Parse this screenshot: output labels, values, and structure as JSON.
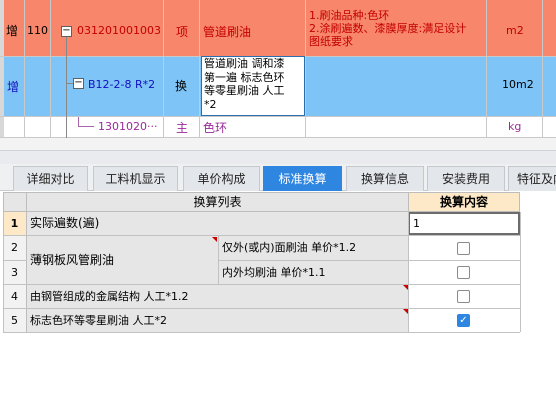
{
  "rows": [
    {
      "op": "增",
      "no": "110",
      "code": "031201001003",
      "type": "项",
      "name": "管道刷油",
      "feature_lines": [
        "1.刷油品种:色环",
        "2.涂刷遍数、漆膜厚度:满足设计",
        "图纸要求"
      ],
      "unit": "m2",
      "expander": "−"
    },
    {
      "op": "增",
      "code": "B12-2-8 R*2",
      "type": "换",
      "name_lines": [
        "管道刷油 调和漆",
        "第一遍  标志色环",
        "等零星刷油 人工",
        "*2"
      ],
      "unit": "10m2",
      "expander": "−"
    },
    {
      "code": "1301020···",
      "type": "主",
      "name": "色环",
      "unit": "kg"
    }
  ],
  "tabs": [
    "详细对比",
    "工料机显示",
    "单价构成",
    "标准换算",
    "换算信息",
    "安装费用",
    "特征及内"
  ],
  "active_tab": "标准换算",
  "table": {
    "col_list": "换算列表",
    "col_content": "换算内容",
    "items": [
      {
        "no": "1",
        "label": "实际遍数(遍)",
        "value": "1"
      },
      {
        "no": "2",
        "group": "薄钢板风管刷油",
        "label": "仅外(或内)面刷油 单价*1.2",
        "checked": false
      },
      {
        "no": "3",
        "label": "内外均刷油 单价*1.1",
        "checked": false
      },
      {
        "no": "4",
        "label": "由钢管组成的金属结构 人工*1.2",
        "checked": false
      },
      {
        "no": "5",
        "label": "标志色环等零星刷油 人工*2",
        "checked": true
      }
    ]
  },
  "colors": {
    "active_tab": "#2f86e0",
    "row_highlight": "#f7866a",
    "row_selected": "#7fc4f6"
  }
}
